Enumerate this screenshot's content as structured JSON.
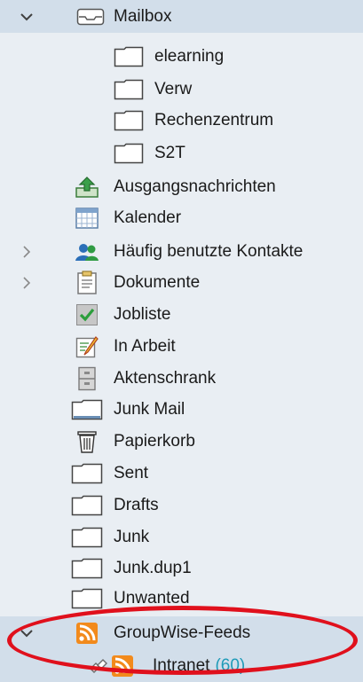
{
  "folders": {
    "mailbox": "Mailbox",
    "elearning": "elearning",
    "verw": "Verw",
    "rechenzentrum": "Rechenzentrum",
    "s2t": "S2T",
    "outbox": "Ausgangsnachrichten",
    "calendar": "Kalender",
    "contacts": "Häufig benutzte Kontakte",
    "documents": "Dokumente",
    "joblist": "Jobliste",
    "in_progress": "In Arbeit",
    "cabinet": "Aktenschrank",
    "junk_mail": "Junk Mail",
    "trash": "Papierkorb",
    "sent": "Sent",
    "drafts": "Drafts",
    "junk": "Junk",
    "junk_dup1": "Junk.dup1",
    "unwanted": "Unwanted",
    "feeds": "GroupWise-Feeds",
    "intranet": "Intranet",
    "intranet_count": "(60)"
  },
  "colors": {
    "highlight": "#d2deea",
    "annotation": "#e0101c",
    "count": "#1f9bb8"
  }
}
